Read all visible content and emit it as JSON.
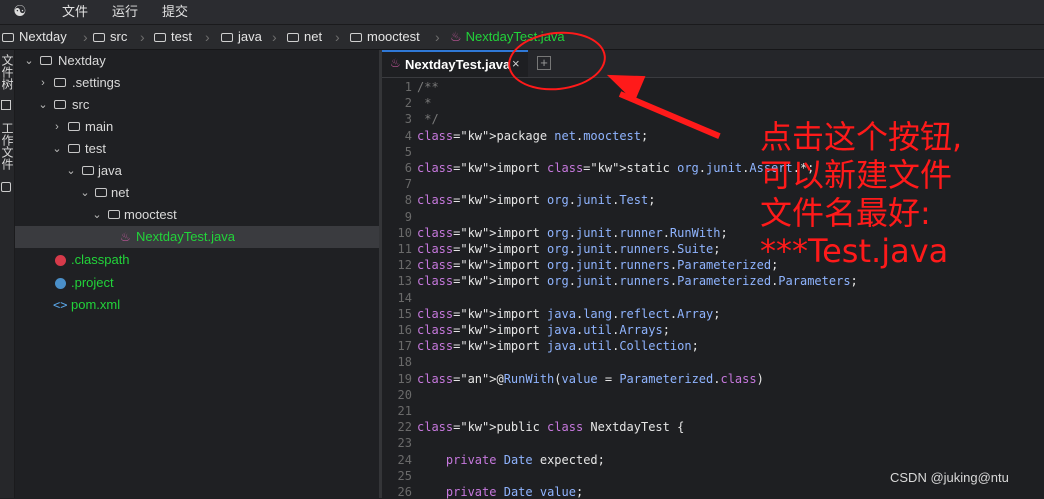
{
  "menu": {
    "logo_icon": "app-logo-icon",
    "items": [
      "文件",
      "运行",
      "提交"
    ]
  },
  "breadcrumb": [
    "Nextday",
    "src",
    "test",
    "java",
    "net",
    "mooctest",
    "NextdayTest.java"
  ],
  "side_tabs": {
    "files": "文件树",
    "work": "工作文件"
  },
  "tree": [
    {
      "label": "Nextday",
      "depth": 0,
      "kind": "folder-open"
    },
    {
      "label": ".settings",
      "depth": 1,
      "kind": "folder-closed"
    },
    {
      "label": "src",
      "depth": 1,
      "kind": "folder-open"
    },
    {
      "label": "main",
      "depth": 2,
      "kind": "folder-closed"
    },
    {
      "label": "test",
      "depth": 2,
      "kind": "folder-open"
    },
    {
      "label": "java",
      "depth": 3,
      "kind": "folder-open"
    },
    {
      "label": "net",
      "depth": 4,
      "kind": "folder-open"
    },
    {
      "label": "mooctest",
      "depth": 5,
      "kind": "folder-open"
    },
    {
      "label": "NextdayTest.java",
      "depth": 6,
      "kind": "java",
      "selected": true
    },
    {
      "label": ".classpath",
      "depth": 1,
      "kind": "classpath"
    },
    {
      "label": ".project",
      "depth": 1,
      "kind": "project"
    },
    {
      "label": "pom.xml",
      "depth": 1,
      "kind": "xml"
    }
  ],
  "editor": {
    "tab_label": "NextdayTest.java",
    "close_glyph": "×",
    "add_glyph": "+",
    "line_numbers": [
      "1",
      "2",
      "3",
      "4",
      "5",
      "6",
      "7",
      "8",
      "9",
      "10",
      "11",
      "12",
      "13",
      "14",
      "15",
      "16",
      "17",
      "18",
      "19",
      "20",
      "21",
      "22",
      "23",
      "24",
      "25",
      "26"
    ],
    "code_lines": [
      "/**",
      " *",
      " */",
      "package net.mooctest;",
      "",
      "import static org.junit.Assert.*;",
      "",
      "import org.junit.Test;",
      "",
      "import org.junit.runner.RunWith;",
      "import org.junit.runners.Suite;",
      "import org.junit.runners.Parameterized;",
      "import org.junit.runners.Parameterized.Parameters;",
      "",
      "import java.lang.reflect.Array;",
      "import java.util.Arrays;",
      "import java.util.Collection;",
      "",
      "@RunWith(value = Parameterized.class)",
      "",
      "",
      "public class NextdayTest {",
      "",
      "    private Date expected;",
      "",
      "    private Date value;"
    ]
  },
  "annotation": {
    "color": "#ff1a1a",
    "lines": [
      "点击这个按钮,",
      "可以新建文件",
      "文件名最好:",
      "***Test.java"
    ]
  },
  "watermark": "CSDN @juking@ntu",
  "colors": {
    "accent": "#2f78d6",
    "active_file": "#22d33a",
    "java_icon": "#c0569a",
    "annotation": "#ff1a1a"
  }
}
